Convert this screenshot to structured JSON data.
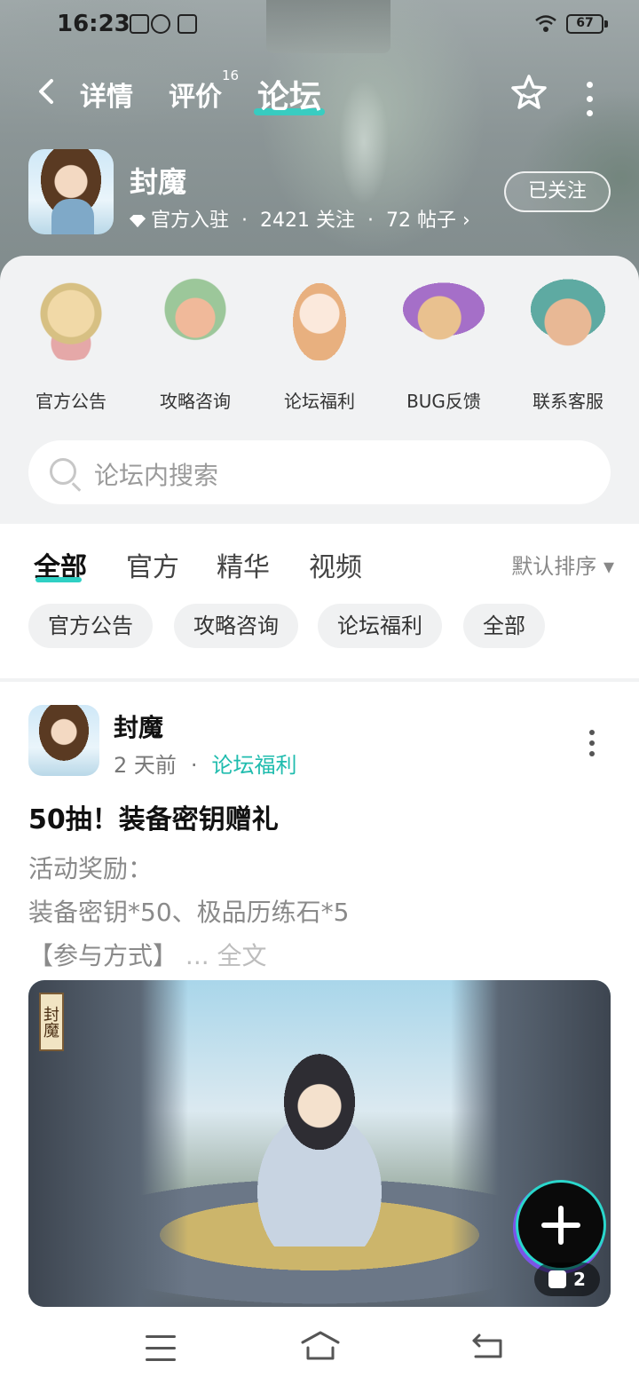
{
  "status_bar": {
    "time": "16:23",
    "battery": "67"
  },
  "nav": {
    "tabs": [
      {
        "label": "详情"
      },
      {
        "label": "评价",
        "badge": "16"
      },
      {
        "label": "论坛"
      }
    ],
    "active_tab": "论坛"
  },
  "app": {
    "name": "封魔",
    "official": "官方入驻",
    "followers": "2421 关注",
    "posts": "72 帖子",
    "follow_button": "已关注"
  },
  "categories": [
    {
      "label": "官方公告"
    },
    {
      "label": "攻略咨询"
    },
    {
      "label": "论坛福利"
    },
    {
      "label": "BUG反馈"
    },
    {
      "label": "联系客服"
    }
  ],
  "search": {
    "placeholder": "论坛内搜索"
  },
  "filter_tabs": [
    {
      "label": "全部"
    },
    {
      "label": "官方"
    },
    {
      "label": "精华"
    },
    {
      "label": "视频"
    }
  ],
  "sort": {
    "label": "默认排序 ▾"
  },
  "chips": [
    {
      "label": "官方公告"
    },
    {
      "label": "攻略咨询"
    },
    {
      "label": "论坛福利"
    },
    {
      "label": "全部"
    }
  ],
  "post": {
    "author": "封魔",
    "time": "2 天前",
    "tag": "论坛福利",
    "title": "50抽！装备密钥赠礼",
    "line1": "活动奖励：",
    "line2": "装备密钥*50、极品历练石*5",
    "line3": "【参与方式】",
    "ellipsis": " ... ",
    "fulltext": "全文",
    "image_sign": "封魔",
    "image_count": "2"
  },
  "colors": {
    "accent": "#2fd0c4",
    "tag": "#20bcae"
  }
}
